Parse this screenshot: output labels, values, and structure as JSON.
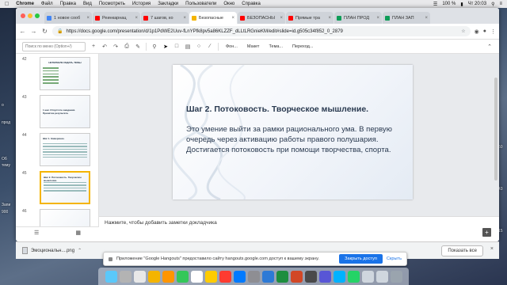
{
  "menubar": {
    "app": "Chrome",
    "items": [
      "Файл",
      "Правка",
      "Вид",
      "Посмотреть",
      "История",
      "Закладки",
      "Пользователи",
      "Окно",
      "Справка"
    ],
    "battery": "100 %",
    "clock": "Чт 20:03"
  },
  "tabs": [
    {
      "label": "1 новое сооб",
      "color": "#4285f4",
      "active": false
    },
    {
      "label": "Реинкарнац",
      "color": "#ff0000",
      "active": false
    },
    {
      "label": "7 шагов, ко",
      "color": "#ff0000",
      "active": false
    },
    {
      "label": "Безопасные",
      "color": "#f4b400",
      "active": true
    },
    {
      "label": "БЕЗОПАСНЫ",
      "color": "#ff0000",
      "active": false
    },
    {
      "label": "Прямые тра",
      "color": "#ff0000",
      "active": false
    },
    {
      "label": "ПЛАН ПРОД",
      "color": "#0f9d58",
      "active": false
    },
    {
      "label": "ПЛАН ЗАП",
      "color": "#0f9d58",
      "active": false
    }
  ],
  "address": {
    "url": "https://docs.google.com/presentation/d/1p1PdWE2Uuv-fLnYPfk8pv5a86KLZZF_dLLtLRGnieKM/edit#slide=id.g505c34f852_0_2879"
  },
  "toolbar": {
    "search_placeholder": "Поиск по меню (Option+/)",
    "background": "Фон...",
    "layout": "Макет",
    "theme": "Тема...",
    "transition": "Переход..."
  },
  "filmstrip": {
    "slides": [
      {
        "num": "42",
        "title": "НЕТЕРЕЕЛЕ ИЗДАТЬ ТЕМЫ"
      },
      {
        "num": "43",
        "title": "1 шаг. Отпустите ожидания. Принятие результата."
      },
      {
        "num": "44",
        "title": "Шаг 1. Намерение."
      },
      {
        "num": "45",
        "title": "Шаг 2. Потоковость. Творческое мышление."
      },
      {
        "num": "46",
        "title": ""
      }
    ]
  },
  "slide": {
    "title": "Шаг 2. Потоковость. Творческое мышление.",
    "body": "Это умение выйти за рамки рационального ума. В первую очередь через активацию работы правого полушария. Достигается потоковость при помощи творчества, спорта."
  },
  "notes": {
    "placeholder": "Нажмите, чтобы добавить заметки докладчика"
  },
  "download": {
    "file": "Эмоциональн....png",
    "show_all": "Показать все"
  },
  "notice": {
    "text": "Приложение \"Google Hangouts\" предоставило сайту hangouts.google.com доступ к вашему экрану.",
    "share_label": "Закрыть доступ",
    "hide_label": "Скрыть"
  },
  "desktop": {
    "left_fragments": [
      "о",
      "прод",
      "Об",
      "тему",
      "Запи",
      "900"
    ],
    "right_fragments": [
      "01.50",
      "26.43",
      "31.15"
    ]
  },
  "colors": {
    "accent": "#1a73e8",
    "selected_slide_border": "#f4b400",
    "slide_text": "#2a3a50"
  }
}
